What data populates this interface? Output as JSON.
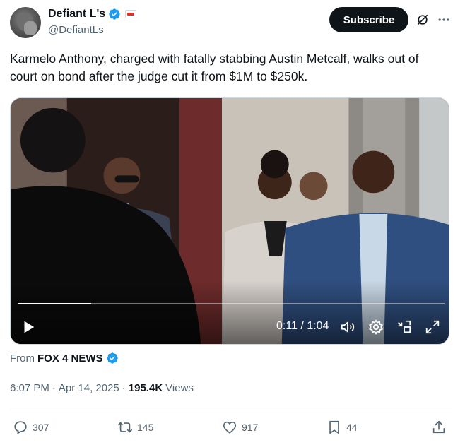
{
  "author": {
    "display_name": "Defiant L's",
    "handle": "@DefiantLs"
  },
  "header": {
    "subscribe_label": "Subscribe"
  },
  "tweet": {
    "text": "Karmelo Anthony, charged with fatally stabbing Austin Metcalf, walks out of court on bond after the judge cut it from $1M to $250k."
  },
  "video": {
    "current_time": "0:11",
    "separator": "/",
    "duration": "1:04",
    "progress": 0.172
  },
  "source": {
    "prefix": "From",
    "name": "FOX 4 NEWS"
  },
  "meta": {
    "time": "6:07 PM",
    "dot": "·",
    "date": "Apr 14, 2025",
    "views_count": "195.4K",
    "views_label": "Views"
  },
  "actions": {
    "replies": "307",
    "reposts": "145",
    "likes": "917",
    "bookmarks": "44"
  },
  "colors": {
    "verified_blue": "#1d9bf0",
    "text_primary": "#0f1419",
    "text_secondary": "#536471"
  },
  "icons": [
    "verified-badge-icon",
    "affiliate-badge-icon",
    "grok-icon",
    "more-icon",
    "play-icon",
    "volume-icon",
    "settings-icon",
    "minimize-icon",
    "fullscreen-icon",
    "reply-icon",
    "repost-icon",
    "like-icon",
    "bookmark-icon",
    "share-icon"
  ]
}
